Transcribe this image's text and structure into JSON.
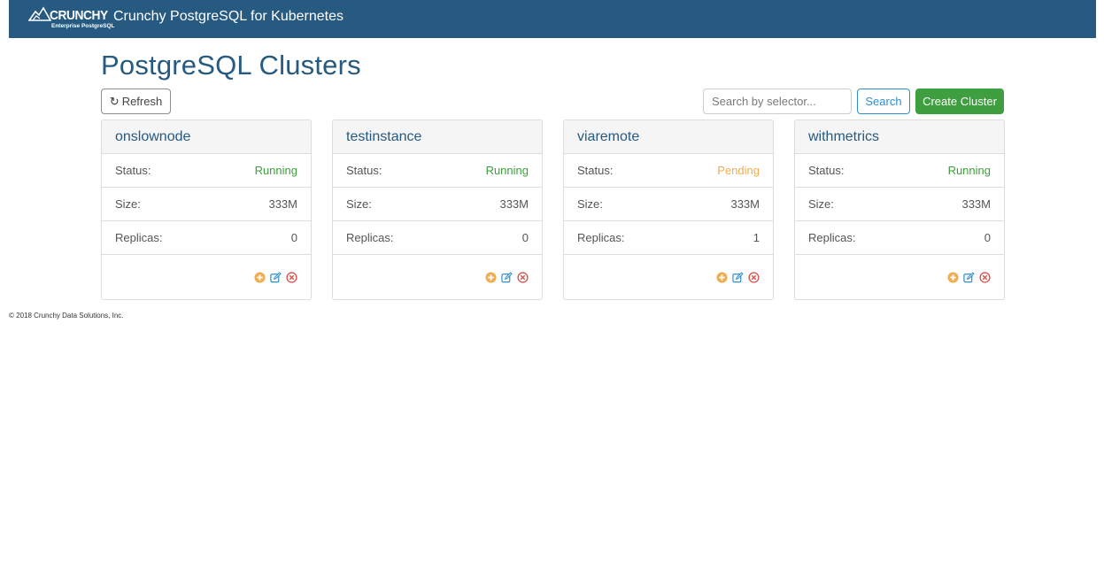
{
  "navbar": {
    "logo_word": "CRUNCHY",
    "logo_sub": "Enterprise PostgreSQL",
    "title": "Crunchy PostgreSQL for Kubernetes"
  },
  "page": {
    "title": "PostgreSQL Clusters"
  },
  "toolbar": {
    "refresh_label": "Refresh",
    "search_placeholder": "Search by selector...",
    "search_label": "Search",
    "create_label": "Create Cluster"
  },
  "labels": {
    "status": "Status:",
    "size": "Size:",
    "replicas": "Replicas:"
  },
  "colors": {
    "running": "#3e9e3e",
    "pending": "#f0ad4e",
    "primary": "#265a80"
  },
  "clusters": [
    {
      "name": "onslownode",
      "status": "Running",
      "size": "333M",
      "replicas": "0"
    },
    {
      "name": "testinstance",
      "status": "Running",
      "size": "333M",
      "replicas": "0"
    },
    {
      "name": "viaremote",
      "status": "Pending",
      "size": "333M",
      "replicas": "1"
    },
    {
      "name": "withmetrics",
      "status": "Running",
      "size": "333M",
      "replicas": "0"
    }
  ],
  "card_actions": [
    "add-replica-icon",
    "edit-icon",
    "delete-icon"
  ],
  "footer": {
    "copyright": "© 2018 Crunchy Data Solutions, Inc."
  }
}
